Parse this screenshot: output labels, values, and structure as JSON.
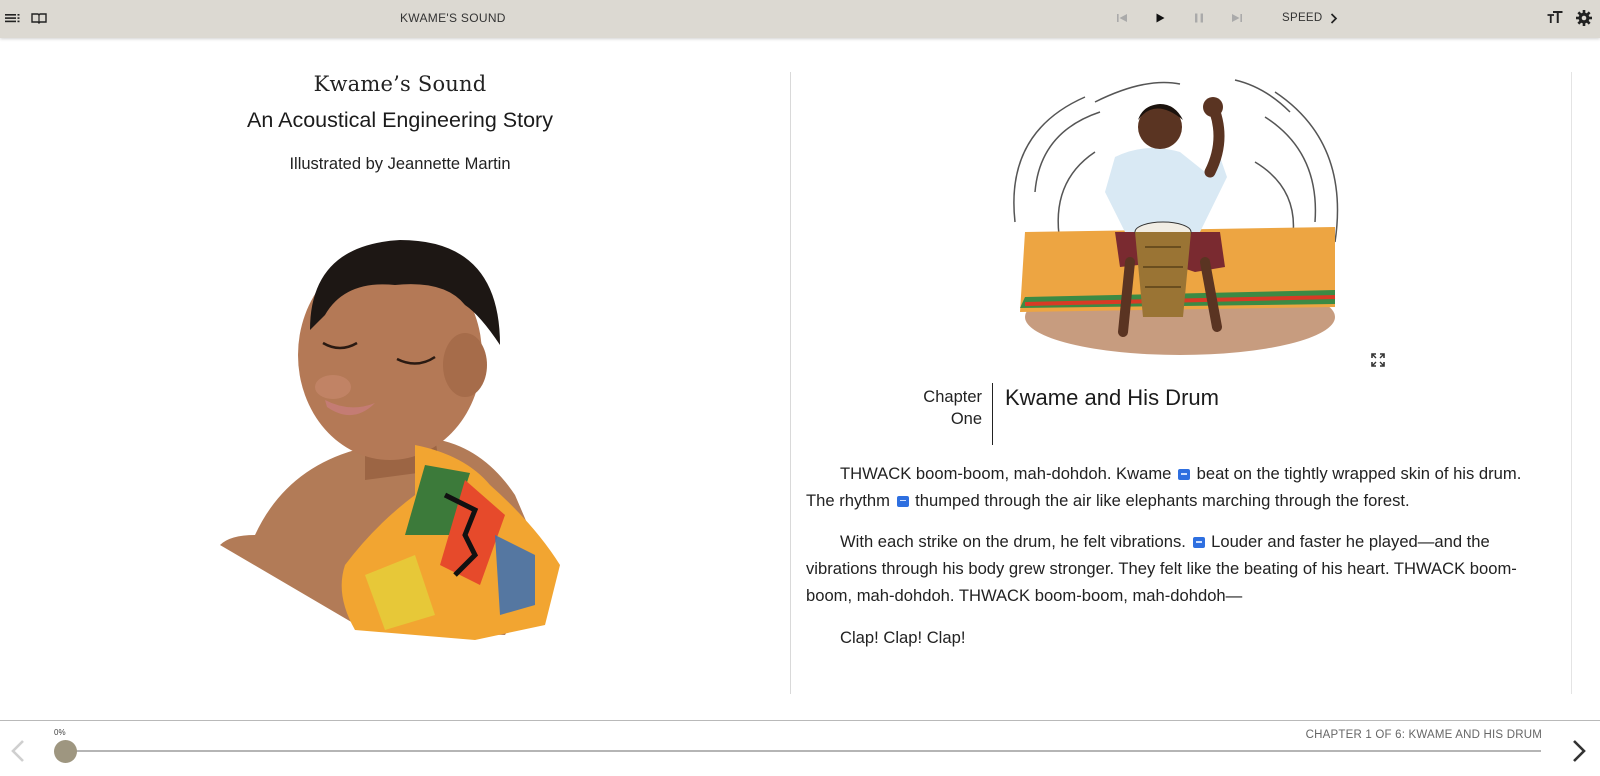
{
  "toolbar": {
    "book_title": "KWAME'S SOUND",
    "speed_label": "SPEED",
    "icons": [
      "menu-icon",
      "library-icon",
      "skip-back-icon",
      "play-icon",
      "pause-icon",
      "skip-forward-icon",
      "chevron-right-icon",
      "text-size-icon",
      "gear-icon"
    ]
  },
  "left_page": {
    "title": "Kwame’s Sound",
    "subtitle": "An Acoustical Engineering Story",
    "illustrator": "Illustrated by Jeannette Martin"
  },
  "right_page": {
    "chapter_label_line1": "Chapter",
    "chapter_label_line2": "One",
    "chapter_title": "Kwame and His Drum",
    "p1_a": "THWACK boom-boom, mah-dohdoh. Kwame",
    "p1_b": "beat on the tightly wrapped skin of his drum. The rhythm",
    "p1_c": "thumped through the air like elephants marching through the forest.",
    "p2_a": "With each strike on the drum, he felt vibrations.",
    "p2_b": "Louder and faster he played—and the vibrations through his body grew stronger. They felt like the beating of his heart. THWACK boom-boom, mah-dohdoh. THWACK boom-boom, mah-dohdoh—",
    "p3": "Clap! Clap! Clap!"
  },
  "footer": {
    "progress_label": "0%",
    "progress_fraction": 0,
    "chapter_status": "CHAPTER 1 OF 6: KWAME AND HIS DRUM"
  },
  "colors": {
    "toolbar_bg": "#dcd9d2",
    "glossary_marker": "#2e6fe0",
    "progress_knob": "#9e9680"
  }
}
